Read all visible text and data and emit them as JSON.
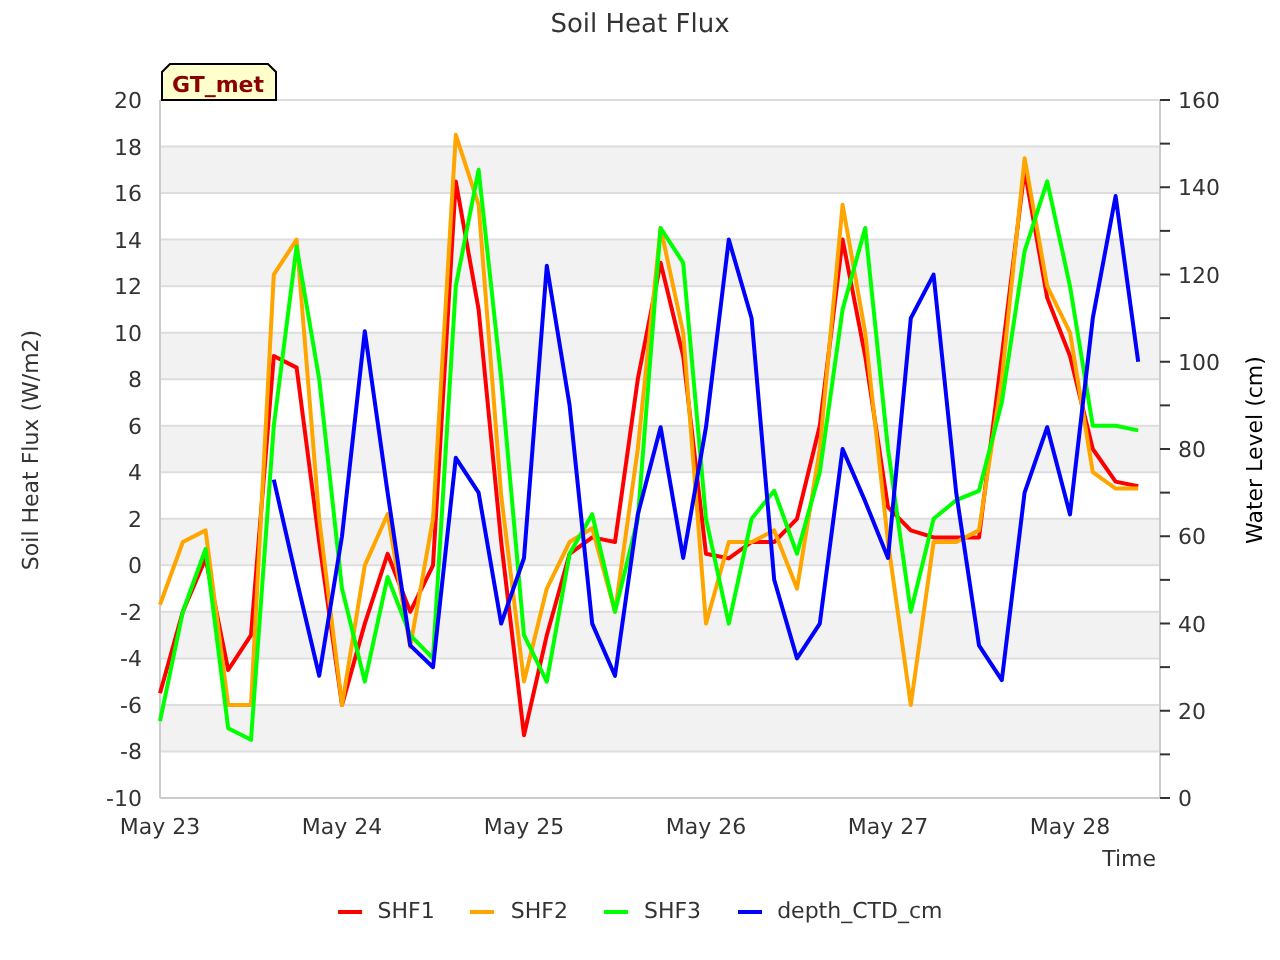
{
  "site_label": "GT_met",
  "chart_data": {
    "type": "line",
    "grid": true,
    "title": "Soil Heat Flux",
    "xlabel": "Time",
    "ylabel": "Soil Heat Flux (W/m2)",
    "y2label": "Water Level (cm)",
    "categories": [
      "May 23",
      null,
      null,
      null,
      null,
      null,
      null,
      null,
      "May 24",
      null,
      null,
      null,
      null,
      null,
      null,
      null,
      "May 25",
      null,
      null,
      null,
      null,
      null,
      null,
      null,
      "May 26",
      null,
      null,
      null,
      null,
      null,
      null,
      null,
      "May 27",
      null,
      null,
      null,
      null,
      null,
      null,
      null,
      "May 28",
      null,
      null,
      null
    ],
    "ylim": [
      -10,
      20
    ],
    "y2lim": [
      0,
      160
    ],
    "yticks": [
      -10,
      -8,
      -6,
      -4,
      -2,
      0,
      2,
      4,
      6,
      8,
      10,
      12,
      14,
      16,
      18,
      20
    ],
    "y2ticks": [
      0,
      20,
      40,
      60,
      80,
      100,
      120,
      140,
      160
    ],
    "series": [
      {
        "name": "SHF1",
        "color": "#ff0000",
        "values": [
          -5.5,
          -2,
          0.3,
          -4.5,
          -3,
          9,
          8.5,
          1,
          -6,
          -2.5,
          0.5,
          -2,
          0,
          16.5,
          11,
          1,
          -7.3,
          -3,
          0.5,
          1.2,
          1,
          8,
          13,
          9,
          0.5,
          0.3,
          1,
          1,
          2,
          6,
          14,
          9,
          2.5,
          1.5,
          1.2,
          1.2,
          1.2,
          9,
          17,
          11.5,
          9,
          5,
          3.6,
          3.4
        ]
      },
      {
        "name": "SHF2",
        "color": "#ffa500",
        "values": [
          -1.7,
          1,
          1.5,
          -6,
          -6,
          12.5,
          14,
          2,
          -6,
          0,
          2.2,
          -3.5,
          2,
          18.5,
          15.5,
          3,
          -5,
          -1,
          1,
          1.6,
          -2,
          5,
          14.5,
          10,
          -2.5,
          1,
          1,
          1.5,
          -1,
          5,
          15.5,
          10,
          1,
          -6,
          1,
          1,
          1.5,
          8,
          17.5,
          12,
          10,
          4,
          3.3,
          3.3
        ]
      },
      {
        "name": "SHF3",
        "color": "#00ff00",
        "values": [
          -6.7,
          -2,
          0.7,
          -7,
          -7.5,
          6,
          13.7,
          8,
          -1,
          -5,
          -0.5,
          -3,
          -4,
          12,
          17,
          8,
          -3,
          -5,
          0.5,
          2.2,
          -2,
          2,
          14.5,
          13,
          2,
          -2.5,
          2,
          3.2,
          0.5,
          4,
          11,
          14.5,
          5,
          -2,
          2,
          2.8,
          3.2,
          7,
          13.5,
          16.5,
          12,
          6,
          6,
          5.8
        ]
      },
      {
        "name": "depth_CTD_cm",
        "color": "#0000ff",
        "axis": "y2",
        "values": [
          null,
          null,
          null,
          null,
          null,
          73,
          50,
          28,
          60,
          107,
          70,
          35,
          30,
          78,
          70,
          40,
          55,
          122,
          90,
          40,
          28,
          65,
          85,
          55,
          85,
          128,
          110,
          50,
          32,
          40,
          80,
          68,
          55,
          110,
          120,
          70,
          35,
          27,
          70,
          85,
          65,
          110,
          138,
          100
        ]
      }
    ]
  }
}
